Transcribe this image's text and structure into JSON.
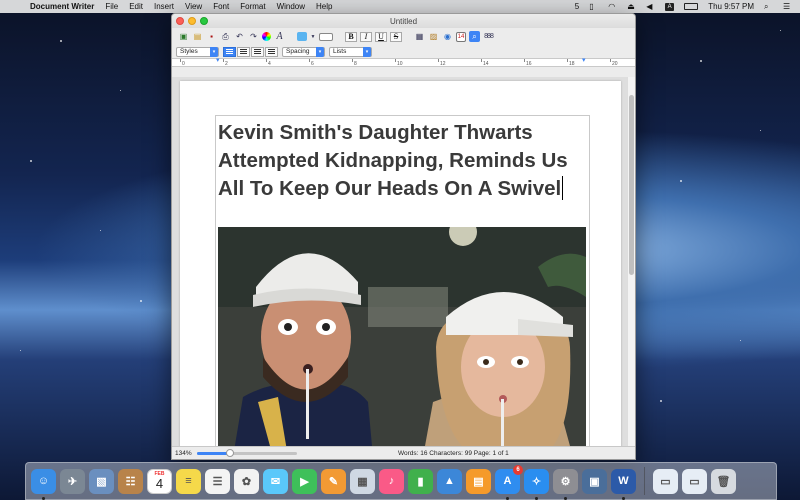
{
  "menubar": {
    "app_name": "Document Writer",
    "menus": [
      "File",
      "Edit",
      "Insert",
      "View",
      "Font",
      "Format",
      "Window",
      "Help"
    ],
    "status": {
      "notification_count": "5",
      "clock": "Thu 9:57 PM"
    }
  },
  "window": {
    "title": "Untitled",
    "toolbar": {
      "bold_label": "B",
      "italic_label": "I",
      "underline_label": "U",
      "strike_label": "S",
      "calendar_day": "14",
      "styles_dropdown": "Styles",
      "spacing_dropdown": "Spacing",
      "lists_dropdown": "Lists"
    },
    "ruler": {
      "labels": [
        "0",
        "2",
        "4",
        "6",
        "8",
        "10",
        "12",
        "14",
        "16",
        "18",
        "20"
      ]
    },
    "document": {
      "headline": "Kevin Smith's Daughter Thwarts Attempted Kidnapping, Reminds Us All To Keep Our Heads On A Swivel",
      "photo_alt": "photo"
    },
    "statusbar": {
      "zoom": "134%",
      "zoom_fraction": 0.33,
      "stats": "Words: 16  Characters: 99  Page: 1 of 1"
    }
  },
  "dock": {
    "calendar_month": "FEB",
    "calendar_day": "4",
    "app_store_badge": "6",
    "items": [
      {
        "name": "Finder",
        "icon": "finder-icon",
        "color": "#3a8ee6"
      },
      {
        "name": "Launchpad",
        "icon": "launchpad-icon",
        "color": "#7b8794"
      },
      {
        "name": "Preview",
        "icon": "preview-icon",
        "color": "#6a8fbf"
      },
      {
        "name": "Contacts",
        "icon": "contacts-icon",
        "color": "#b8834a"
      },
      {
        "name": "Calendar",
        "icon": "calendar-icon",
        "color": "#ffffff"
      },
      {
        "name": "Notes",
        "icon": "notes-icon",
        "color": "#f5d94a"
      },
      {
        "name": "Reminders",
        "icon": "reminders-icon",
        "color": "#f4f4f4"
      },
      {
        "name": "Photos",
        "icon": "photos-icon",
        "color": "#f2f2f2"
      },
      {
        "name": "Messages",
        "icon": "messages-icon",
        "color": "#5ac8fa"
      },
      {
        "name": "FaceTime",
        "icon": "facetime-icon",
        "color": "#3ec05a"
      },
      {
        "name": "Pages",
        "icon": "pages-icon",
        "color": "#f29a34"
      },
      {
        "name": "Keynote Remote",
        "icon": "image-capture-icon",
        "color": "#cfd8e3"
      },
      {
        "name": "Music",
        "icon": "music-icon",
        "color": "#fa5a87"
      },
      {
        "name": "Numbers",
        "icon": "numbers-icon",
        "color": "#40b04c"
      },
      {
        "name": "Keynote",
        "icon": "keynote-icon",
        "color": "#3c87d8"
      },
      {
        "name": "Books",
        "icon": "books-icon",
        "color": "#f59a2a"
      },
      {
        "name": "App Store",
        "icon": "app-store-icon",
        "color": "#2f8df0"
      },
      {
        "name": "Safari",
        "icon": "safari-icon",
        "color": "#2a8ef0"
      },
      {
        "name": "System Preferences",
        "icon": "system-preferences-icon",
        "color": "#8e8e93"
      },
      {
        "name": "Image Capture",
        "icon": "photo-booth-icon",
        "color": "#4a6e9a"
      },
      {
        "name": "Document Writer",
        "icon": "document-writer-icon",
        "color": "#2c5aa8"
      },
      {
        "name": "Downloads",
        "icon": "downloads-stack-icon",
        "color": "#e6edf5"
      },
      {
        "name": "Documents",
        "icon": "documents-stack-icon",
        "color": "#e6edf5"
      },
      {
        "name": "Trash",
        "icon": "trash-icon",
        "color": "#d6dadf"
      }
    ]
  }
}
